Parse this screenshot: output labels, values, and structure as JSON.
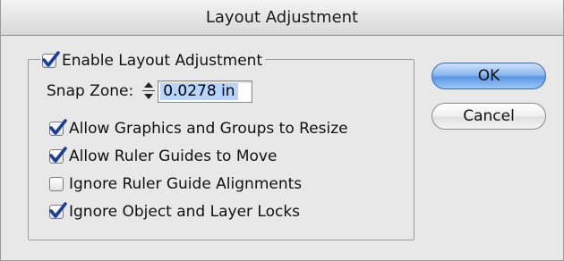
{
  "window": {
    "title": "Layout Adjustment"
  },
  "group": {
    "enable_label": "Enable Layout Adjustment",
    "enable_checked": true
  },
  "snap_zone": {
    "label": "Snap Zone:",
    "value": "0.0278 in"
  },
  "options": [
    {
      "label": "Allow Graphics and Groups to Resize",
      "checked": true
    },
    {
      "label": "Allow Ruler Guides to Move",
      "checked": true
    },
    {
      "label": "Ignore Ruler Guide Alignments",
      "checked": false
    },
    {
      "label": "Ignore Object and Layer Locks",
      "checked": true
    }
  ],
  "buttons": {
    "ok_label": "OK",
    "cancel_label": "Cancel"
  },
  "colors": {
    "checkmark": "#1b3f96",
    "default_button": "#5c95e3",
    "selection": "#b5d5ff"
  }
}
